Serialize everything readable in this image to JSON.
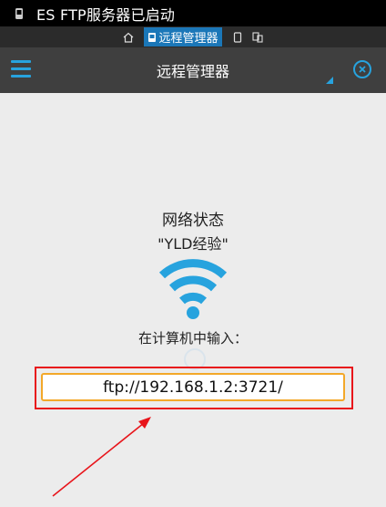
{
  "status_bar": {
    "text": "ES FTP服务器已启动",
    "icon": "phone-icon"
  },
  "crumb_bar": {
    "active_label": "远程管理器",
    "icons": [
      "home-icon",
      "remote-icon",
      "sdcard-icon",
      "device-icon"
    ]
  },
  "app_bar": {
    "title": "远程管理器",
    "menu_icon": "hamburger-menu-icon",
    "close_icon": "close-circle-icon"
  },
  "network": {
    "title": "网络状态",
    "name": "\"YLD经验\"",
    "icon": "wifi-icon"
  },
  "prompt": "在计算机中输入：",
  "ftp": {
    "url": "ftp://192.168.1.2:3721/"
  },
  "colors": {
    "accent": "#27a3de",
    "highlight": "#e8151b",
    "field_border": "#f3a829",
    "app_bar": "#3f3f3f"
  }
}
